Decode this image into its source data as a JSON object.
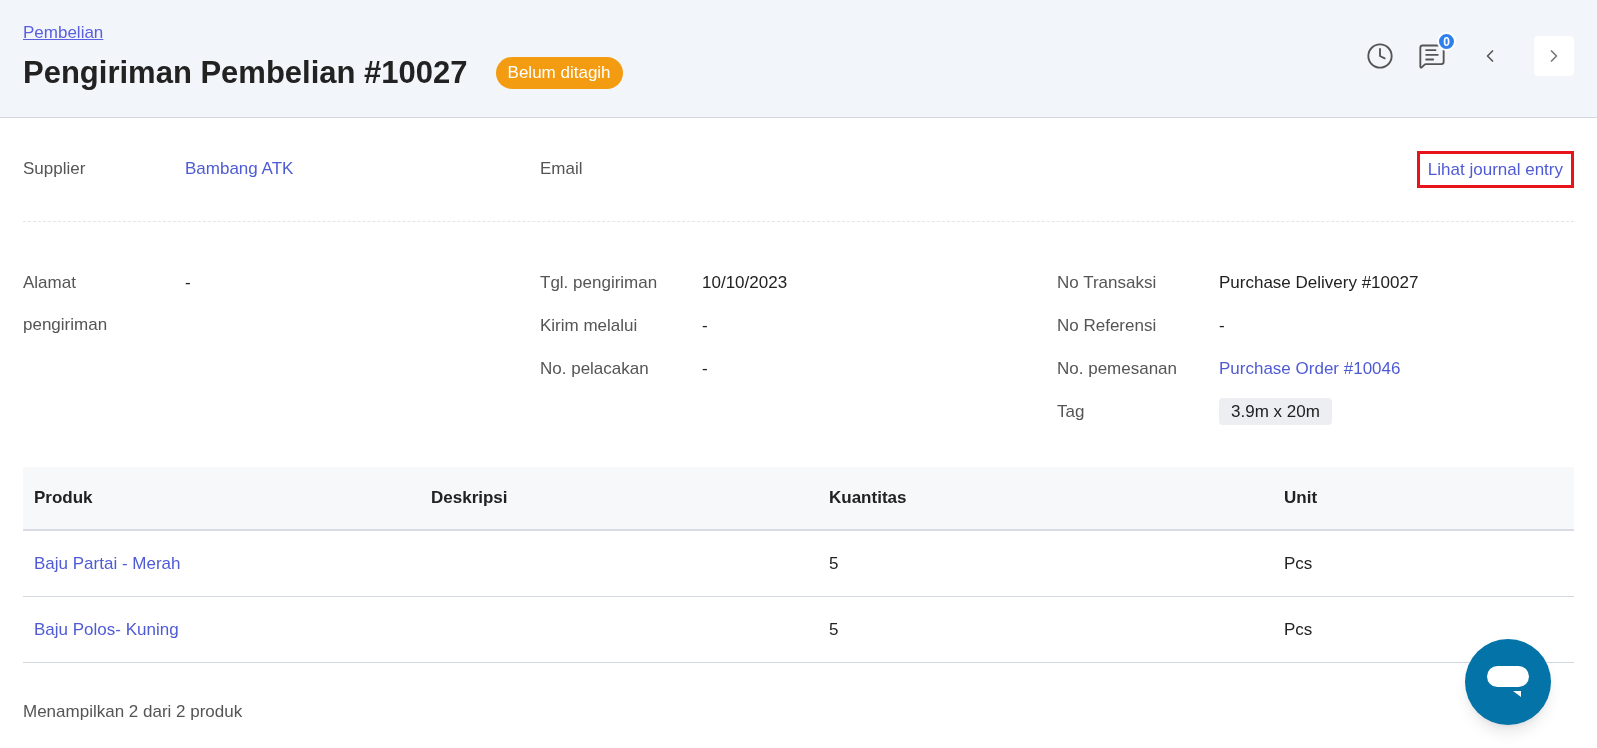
{
  "header": {
    "breadcrumb": "Pembelian",
    "title": "Pengiriman Pembelian #10027",
    "status_badge": "Belum ditagih",
    "comment_count": "0"
  },
  "top_fields": [
    {
      "label": "Supplier",
      "value": "Bambang ATK",
      "kind": "link"
    },
    {
      "label": "Email"
    }
  ],
  "journal_link": {
    "label": "Lihat journal entry",
    "highlighted": true
  },
  "detail_columns": [
    [
      {
        "label": "Alamat pengiriman",
        "value": "-",
        "kind": "text"
      }
    ],
    [
      {
        "label": "Tgl. pengiriman",
        "value": "10/10/2023",
        "kind": "text"
      },
      {
        "label": "Kirim melalui",
        "value": "-",
        "kind": "text"
      },
      {
        "label": "No. pelacakan",
        "value": "-",
        "kind": "text"
      }
    ],
    [
      {
        "label": "No Transaksi",
        "value": "Purchase Delivery #10027",
        "kind": "text"
      },
      {
        "label": "No Referensi",
        "value": "-",
        "kind": "text"
      },
      {
        "label": "No. pemesanan",
        "value": "Purchase Order #10046",
        "kind": "link"
      },
      {
        "label": "Tag",
        "value": "3.9m x 20m",
        "kind": "tag"
      }
    ]
  ],
  "table": {
    "columns": [
      "Produk",
      "Deskripsi",
      "Kuantitas",
      "Unit"
    ],
    "rows": [
      [
        "Baju Partai - Merah",
        "",
        "5",
        "Pcs"
      ],
      [
        "Baju Polos- Kuning",
        "",
        "5",
        "Pcs"
      ]
    ]
  },
  "footer": "Menampilkan 2 dari 2 produk"
}
